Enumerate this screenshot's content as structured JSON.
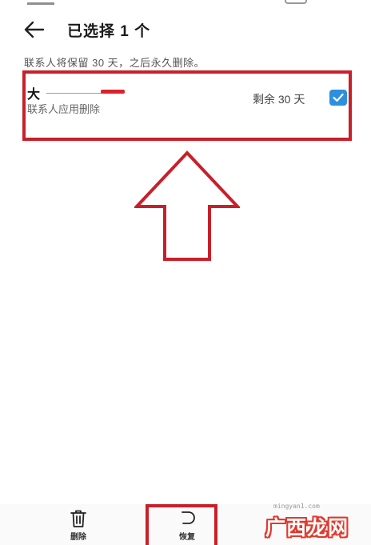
{
  "header": {
    "back_icon": "arrow-left-icon",
    "title": "已选择 1 个"
  },
  "notice": "联系人将保留 30 天，之后永久删除。",
  "contact": {
    "name_visible": "大",
    "source": "联系人应用删除",
    "remaining": "剩余 30 天",
    "selected": true
  },
  "bottom_actions": [
    {
      "label": "删除",
      "icon": "trash-icon"
    },
    {
      "label": "恢复",
      "icon": "restore-icon"
    }
  ],
  "watermark": {
    "url": "mingyan1.com",
    "logo": "广西龙网"
  },
  "colors": {
    "highlight": "#c8202a",
    "checkbox": "#2e8fde"
  }
}
